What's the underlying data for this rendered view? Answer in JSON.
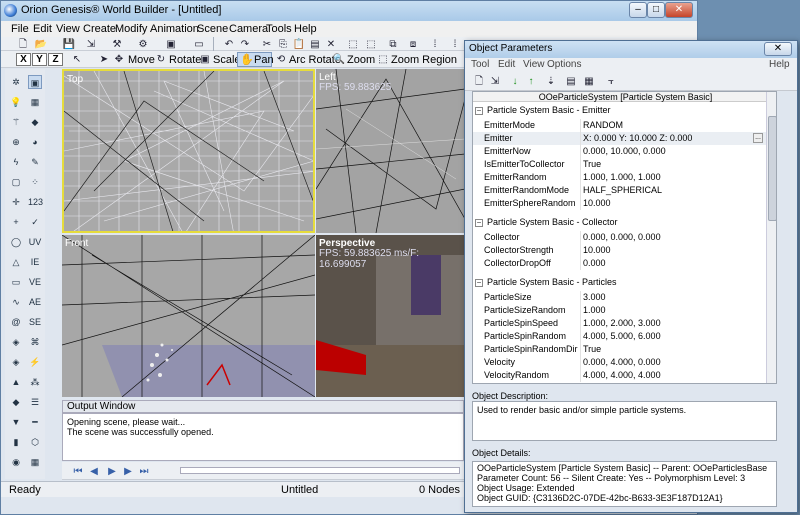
{
  "main_window": {
    "title": "Orion Genesis® World Builder - [Untitled]",
    "controls": {
      "minimize": "–",
      "maximize": "□",
      "close": "✕"
    }
  },
  "menu": [
    "File",
    "Edit",
    "View",
    "Create",
    "Modify",
    "Animation",
    "Scene",
    "Camera",
    "Tools",
    "Help"
  ],
  "toolbar2": {
    "axes": [
      "X",
      "Y",
      "Z"
    ],
    "move": "Move",
    "rotate": "Rotate",
    "scale": "Scale",
    "pan": "Pan",
    "arc_rotate": "Arc Rotate",
    "zoom": "Zoom",
    "zoom_region": "Zoom Region"
  },
  "palette_labels": [
    "123",
    "UV",
    "IE",
    "VE",
    "AE",
    "SE"
  ],
  "viewports": {
    "top": {
      "label": "Top"
    },
    "left": {
      "label": "Left",
      "fps": "FPS: 59.883625"
    },
    "front": {
      "label": "Front"
    },
    "perspective": {
      "label": "Perspective",
      "fps": "FPS: 59.883625    ms/F: 16.699057"
    }
  },
  "output": {
    "title": "Output Window",
    "lines": [
      "Opening scene, please wait...",
      "The scene was successfully opened."
    ]
  },
  "status": {
    "ready": "Ready",
    "doc": "Untitled",
    "nodes": "0 Nodes"
  },
  "dialog": {
    "title": "Object Parameters",
    "menu": {
      "tool": "Tool",
      "edit": "Edit",
      "view": "View",
      "options": "Options",
      "help": "Help"
    },
    "header": "OOeParticleSystem [Particle System Basic]",
    "categories": [
      {
        "title": "Particle System Basic - Emitter",
        "expander": "−",
        "props": [
          {
            "name": "EmitterMode",
            "value": "RANDOM"
          },
          {
            "name": "Emitter",
            "value": "X: 0.000           Y: 10.000          Z: 0.000"
          },
          {
            "name": "EmitterNow",
            "value": "0.000, 10.000, 0.000"
          },
          {
            "name": "IsEmitterToCollector",
            "value": "True"
          },
          {
            "name": "EmitterRandom",
            "value": "1.000, 1.000, 1.000"
          },
          {
            "name": "EmitterRandomMode",
            "value": "HALF_SPHERICAL"
          },
          {
            "name": "EmitterSphereRandom",
            "value": "10.000"
          }
        ]
      },
      {
        "title": "Particle System Basic - Collector",
        "expander": "−",
        "props": [
          {
            "name": "Collector",
            "value": "0.000, 0.000, 0.000"
          },
          {
            "name": "CollectorStrength",
            "value": "10.000"
          },
          {
            "name": "CollectorDropOff",
            "value": "0.000"
          }
        ]
      },
      {
        "title": "Particle System Basic - Particles",
        "expander": "−",
        "props": [
          {
            "name": "ParticleSize",
            "value": "3.000"
          },
          {
            "name": "ParticleSizeRandom",
            "value": "1.000"
          },
          {
            "name": "ParticleSpinSpeed",
            "value": "1.000, 2.000, 3.000"
          },
          {
            "name": "ParticleSpinRandom",
            "value": "4.000, 5.000, 6.000"
          },
          {
            "name": "ParticleSpinRandomDir",
            "value": "True"
          },
          {
            "name": "Velocity",
            "value": "0.000, 4.000, 0.000"
          },
          {
            "name": "VelocityRandom",
            "value": "4.000, 4.000, 4.000"
          }
        ]
      }
    ],
    "description_label": "Object Description:",
    "description": "Used to render basic and/or simple particle systems.",
    "details_label": "Object Details:",
    "details": [
      "OOeParticleSystem [Particle System Basic] -- Parent: OOeParticlesBase",
      "Parameter Count: 56 -- Silent Create: Yes -- Polymorphism Level: 3",
      "Object Usage: Extended",
      "Object GUID: {C3136D2C-07DE-42bc-B633-3E3F187D12A1}"
    ]
  }
}
